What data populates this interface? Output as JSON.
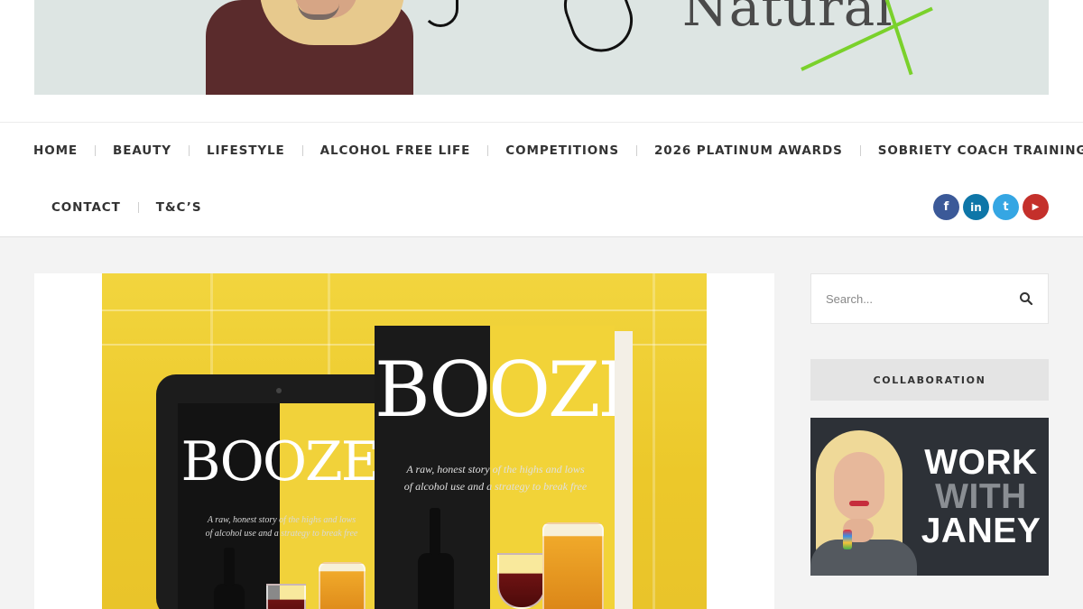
{
  "header": {
    "brand_text": "Natural"
  },
  "nav": {
    "row1": [
      "HOME",
      "BEAUTY",
      "LIFESTYLE",
      "ALCOHOL FREE LIFE",
      "COMPETITIONS",
      "2026 PLATINUM AWARDS",
      "SOBRIETY COACH TRAINING"
    ],
    "row2": [
      "CONTACT",
      "T&C’S"
    ]
  },
  "social": [
    {
      "name": "facebook-icon",
      "glyph": "f",
      "color": "#3b5998"
    },
    {
      "name": "linkedin-icon",
      "glyph": "in",
      "color": "#0e76a8"
    },
    {
      "name": "twitter-icon",
      "glyph": "t",
      "color": "#35a6e3"
    },
    {
      "name": "youtube-icon",
      "glyph": "▶",
      "color": "#c4302b"
    }
  ],
  "hero": {
    "book_title": "BOOZE",
    "book_subtitle_line1": "A raw, honest story of the highs and lows",
    "book_subtitle_line2": "of alcohol use and a strategy to break free"
  },
  "sidebar": {
    "search_placeholder": "Search...",
    "section_title": "COLLABORATION",
    "promo_line1": "WORK",
    "promo_line2": "WITH",
    "promo_line3": "JANEY"
  },
  "colors": {
    "hero_yellow": "#f4d22f",
    "accent_green": "#7ad12b"
  }
}
